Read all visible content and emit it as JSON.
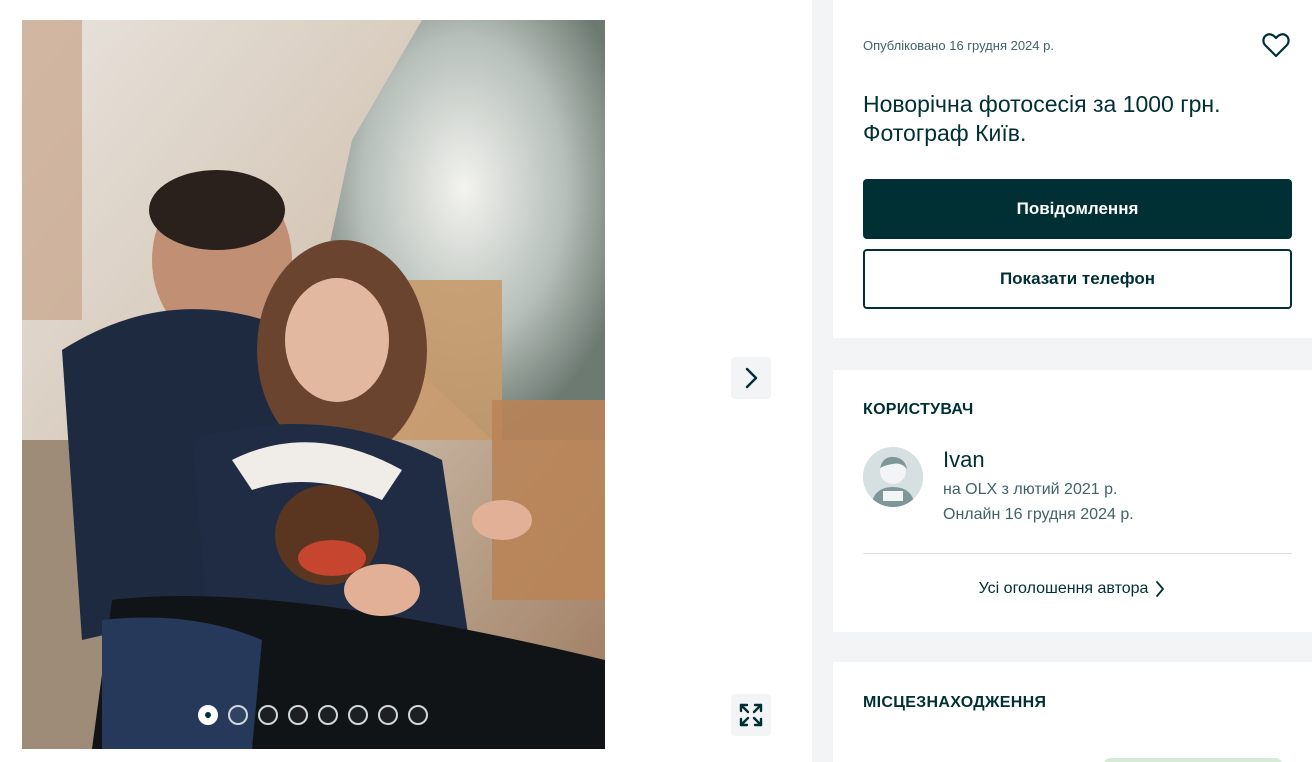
{
  "listing": {
    "published": "Опубліковано 16 грудня 2024 р.",
    "title": "Новорічна фотосесія за 1000 грн. Фотограф Київ.",
    "message_button": "Повідомлення",
    "phone_button": "Показати телефон"
  },
  "gallery": {
    "total_images": 8,
    "active_index": 0
  },
  "user": {
    "heading": "КОРИСТУВАЧ",
    "name": "Ivan",
    "since": "на OLX з лютий 2021 р.",
    "online": "Онлайн 16 грудня 2024 р.",
    "all_ads_link": "Усі оголошення автора"
  },
  "location": {
    "heading": "МІСЦЕЗНАХОДЖЕННЯ"
  },
  "icons": {
    "favorite": "heart-icon",
    "next": "chevron-right-icon",
    "fullscreen": "expand-icon",
    "link_arrow": "chevron-right-icon"
  },
  "colors": {
    "primary": "#002f34",
    "secondary_text": "#406367",
    "background": "#f2f4f5"
  }
}
